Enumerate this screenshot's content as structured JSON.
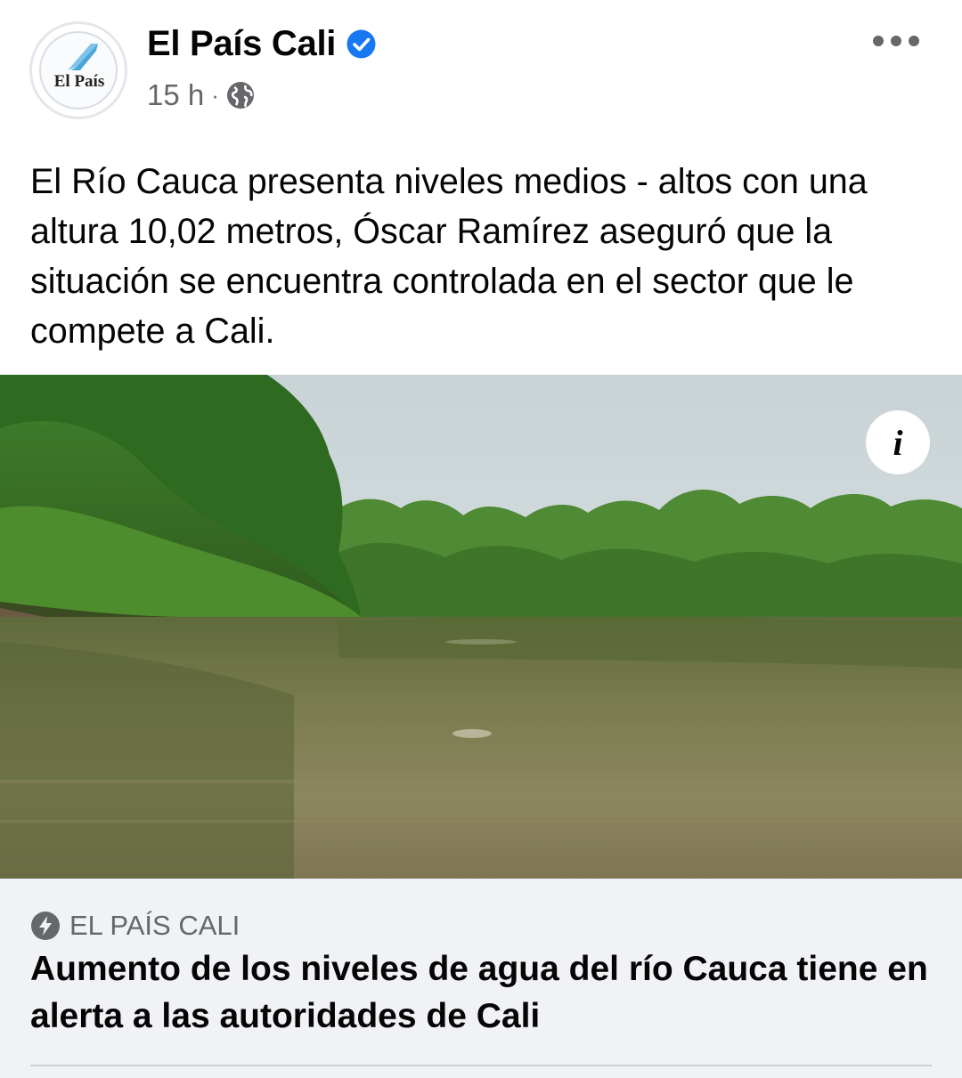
{
  "post": {
    "page_name": "El País Cali",
    "avatar_text": "El País",
    "timestamp": "15 h",
    "separator": "·",
    "privacy_icon": "globe-icon",
    "verified_icon": "verified-badge-icon",
    "more_icon": "more-options-icon",
    "text": "El Río Cauca presenta niveles medios - altos con una altura 10,02 metros, Óscar Ramírez aseguró que la situación se encuentra controlada en el sector que le compete a Cali."
  },
  "photo": {
    "info_label": "i",
    "info_icon": "info-icon"
  },
  "link": {
    "source_icon": "bolt-icon",
    "source": "EL PAÍS CALI",
    "headline": "Aumento de los niveles de agua del río Cauca tiene en alerta a las autoridades de Cali"
  },
  "colors": {
    "verified_blue": "#1877f2",
    "secondary_text": "#65676b",
    "card_background": "#f0f2f5"
  }
}
